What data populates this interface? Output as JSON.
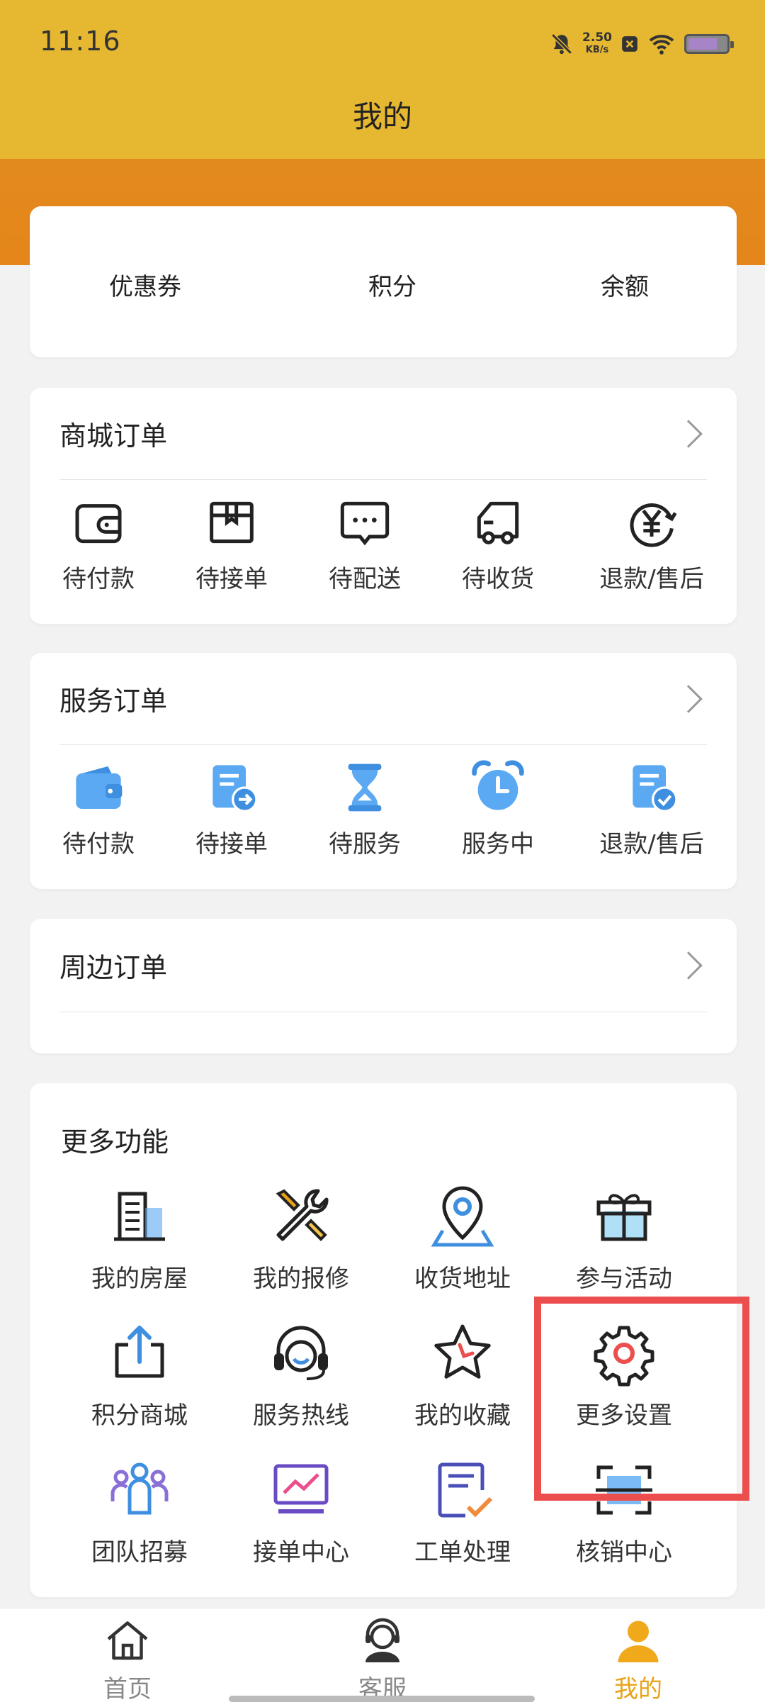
{
  "status_bar": {
    "time": "11:16",
    "speed_value": "2.50",
    "speed_unit": "KB/s"
  },
  "header": {
    "title": "我的"
  },
  "wallet": {
    "coupon": "优惠券",
    "points": "积分",
    "balance": "余额"
  },
  "mall_orders": {
    "title": "商城订单",
    "items": [
      {
        "label": "待付款",
        "icon": "wallet-icon"
      },
      {
        "label": "待接单",
        "icon": "package-icon"
      },
      {
        "label": "待配送",
        "icon": "message-icon"
      },
      {
        "label": "待收货",
        "icon": "truck-icon"
      },
      {
        "label": "退款/售后",
        "icon": "refund-yen-icon"
      }
    ]
  },
  "service_orders": {
    "title": "服务订单",
    "items": [
      {
        "label": "待付款",
        "icon": "wallet-icon"
      },
      {
        "label": "待接单",
        "icon": "document-arrow-icon"
      },
      {
        "label": "待服务",
        "icon": "hourglass-icon"
      },
      {
        "label": "服务中",
        "icon": "alarm-clock-icon"
      },
      {
        "label": "退款/售后",
        "icon": "document-check-icon"
      }
    ]
  },
  "nearby_orders": {
    "title": "周边订单"
  },
  "more_functions": {
    "title": "更多功能",
    "items": [
      {
        "label": "我的房屋",
        "icon": "building-icon"
      },
      {
        "label": "我的报修",
        "icon": "tools-icon"
      },
      {
        "label": "收货地址",
        "icon": "location-pin-icon"
      },
      {
        "label": "参与活动",
        "icon": "gift-icon"
      },
      {
        "label": "积分商城",
        "icon": "share-upload-icon"
      },
      {
        "label": "服务热线",
        "icon": "headset-icon"
      },
      {
        "label": "我的收藏",
        "icon": "star-icon"
      },
      {
        "label": "更多设置",
        "icon": "gear-icon"
      },
      {
        "label": "团队招募",
        "icon": "team-icon"
      },
      {
        "label": "接单中心",
        "icon": "monitor-chart-icon"
      },
      {
        "label": "工单处理",
        "icon": "work-order-icon"
      },
      {
        "label": "核销中心",
        "icon": "scan-icon"
      }
    ]
  },
  "bottom_nav": {
    "items": [
      {
        "label": "首页",
        "icon": "home-icon"
      },
      {
        "label": "客服",
        "icon": "customer-service-icon"
      },
      {
        "label": "我的",
        "icon": "user-icon"
      }
    ],
    "active_color": "#e8a317"
  },
  "colors": {
    "header": "#e6b831",
    "band": "#e4861a",
    "accent_blue": "#4a9fe8",
    "highlight": "#ec4d4d"
  }
}
